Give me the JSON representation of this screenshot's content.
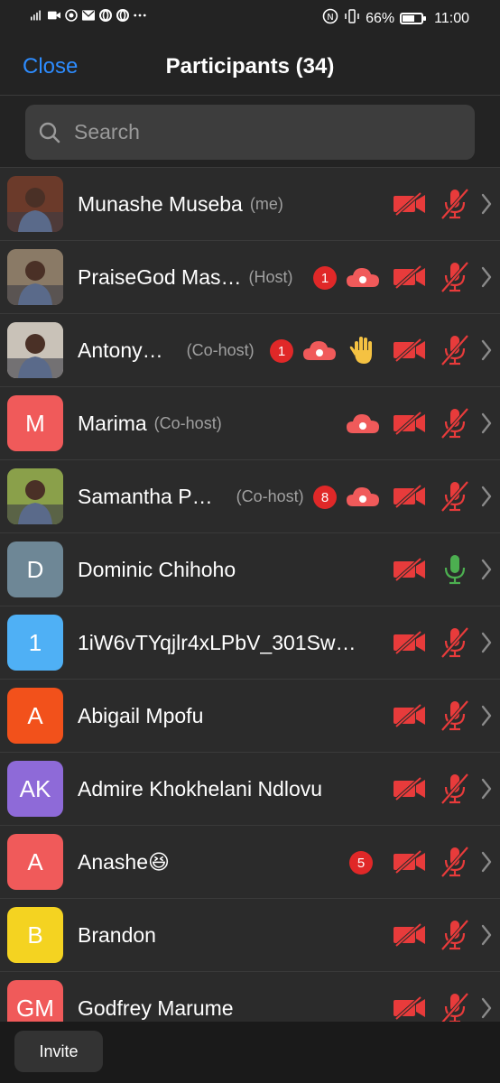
{
  "status_bar": {
    "battery_percent": "66%",
    "battery_level": 0.66,
    "time": "11:00",
    "left_icons": [
      "signal-icon",
      "video-icon",
      "whatsapp-icon",
      "mail-icon",
      "opera-icon",
      "opera-icon",
      "more-dots-icon"
    ],
    "right_icons": [
      "nfc-icon",
      "vibrate-icon"
    ]
  },
  "header": {
    "close_label": "Close",
    "title": "Participants (34)"
  },
  "search": {
    "placeholder": "Search"
  },
  "colors": {
    "accent": "#2d8cff",
    "muted_red": "#e83b3b",
    "mic_green": "#4caf50",
    "badge_red": "#e02828",
    "cloud_red": "#f05a5a",
    "raise_hand": "#f5c242"
  },
  "participants": [
    {
      "name": "Munashe Museba",
      "role": "(me)",
      "avatar": "photo",
      "avatar_color": "#6b3a2a",
      "chat_badge": "",
      "cloud": false,
      "hand": false,
      "video_off": true,
      "mic": "muted"
    },
    {
      "name": "PraiseGod Mas…",
      "role": "(Host)",
      "avatar": "photo",
      "avatar_color": "#8a7a66",
      "chat_badge": "1",
      "cloud": true,
      "hand": false,
      "video_off": true,
      "mic": "muted"
    },
    {
      "name": "Antony…",
      "role": "(Co-host)",
      "avatar": "photo",
      "avatar_color": "#c9c2b8",
      "chat_badge": "1",
      "cloud": true,
      "hand": true,
      "video_off": true,
      "mic": "muted"
    },
    {
      "name": "Marima",
      "role": "(Co-host)",
      "avatar": "M",
      "avatar_color": "#f05a5a",
      "chat_badge": "",
      "cloud": true,
      "hand": false,
      "video_off": true,
      "mic": "muted"
    },
    {
      "name": "Samantha P…",
      "role": "(Co-host)",
      "avatar": "photo",
      "avatar_color": "#8aa04a",
      "chat_badge": "8",
      "cloud": true,
      "hand": false,
      "video_off": true,
      "mic": "muted"
    },
    {
      "name": "Dominic Chihoho",
      "role": "",
      "avatar": "D",
      "avatar_color": "#6e8796",
      "chat_badge": "",
      "cloud": false,
      "hand": false,
      "video_off": true,
      "mic": "on"
    },
    {
      "name": "1iW6vTYqjlr4xLPbV_301Sw…",
      "role": "",
      "avatar": "1",
      "avatar_color": "#4fb0f5",
      "chat_badge": "",
      "cloud": false,
      "hand": false,
      "video_off": true,
      "mic": "muted"
    },
    {
      "name": "Abigail Mpofu",
      "role": "",
      "avatar": "A",
      "avatar_color": "#f2511b",
      "chat_badge": "",
      "cloud": false,
      "hand": false,
      "video_off": true,
      "mic": "muted"
    },
    {
      "name": "Admire Khokhelani Ndlovu",
      "role": "",
      "avatar": "AK",
      "avatar_color": "#8e6ad8",
      "chat_badge": "",
      "cloud": false,
      "hand": false,
      "video_off": true,
      "mic": "muted"
    },
    {
      "name": "Anashe😆",
      "role": "",
      "avatar": "A",
      "avatar_color": "#f05a5a",
      "chat_badge": "5",
      "cloud": false,
      "hand": false,
      "video_off": true,
      "mic": "muted"
    },
    {
      "name": "Brandon",
      "role": "",
      "avatar": "B",
      "avatar_color": "#f4d321",
      "chat_badge": "",
      "cloud": false,
      "hand": false,
      "video_off": true,
      "mic": "muted"
    },
    {
      "name": "Godfrey Marume",
      "role": "",
      "avatar": "GM",
      "avatar_color": "#f05a5a",
      "chat_badge": "",
      "cloud": false,
      "hand": false,
      "video_off": true,
      "mic": "muted"
    }
  ],
  "bottom_bar": {
    "invite_label": "Invite"
  }
}
